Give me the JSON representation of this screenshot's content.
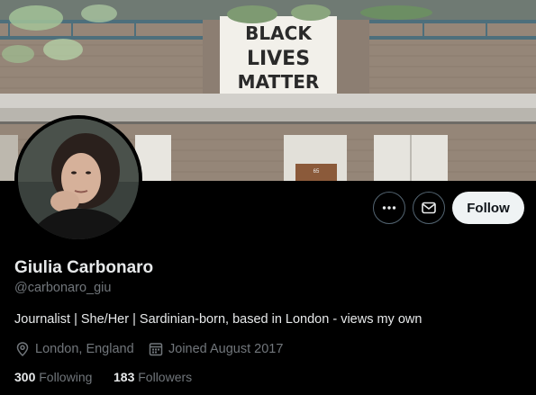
{
  "banner": {
    "sign_lines": [
      "BLACK",
      "LIVES",
      "MATTER"
    ],
    "door_number": "65"
  },
  "profile": {
    "name": "Giulia Carbonaro",
    "handle": "@carbonaro_giu",
    "bio": "Journalist | She/Her | Sardinian-born, based in London - views my own",
    "location": "London, England",
    "joined": "Joined August 2017",
    "following_count": "300",
    "following_label": "Following",
    "followers_count": "183",
    "followers_label": "Followers"
  },
  "actions": {
    "follow_label": "Follow",
    "more_icon": "more-horizontal-icon",
    "message_icon": "envelope-icon"
  },
  "colors": {
    "background": "#000000",
    "primary_text": "#e7e9ea",
    "secondary_text": "#71767b",
    "button_border": "#536471",
    "follow_bg": "#eff3f4"
  }
}
